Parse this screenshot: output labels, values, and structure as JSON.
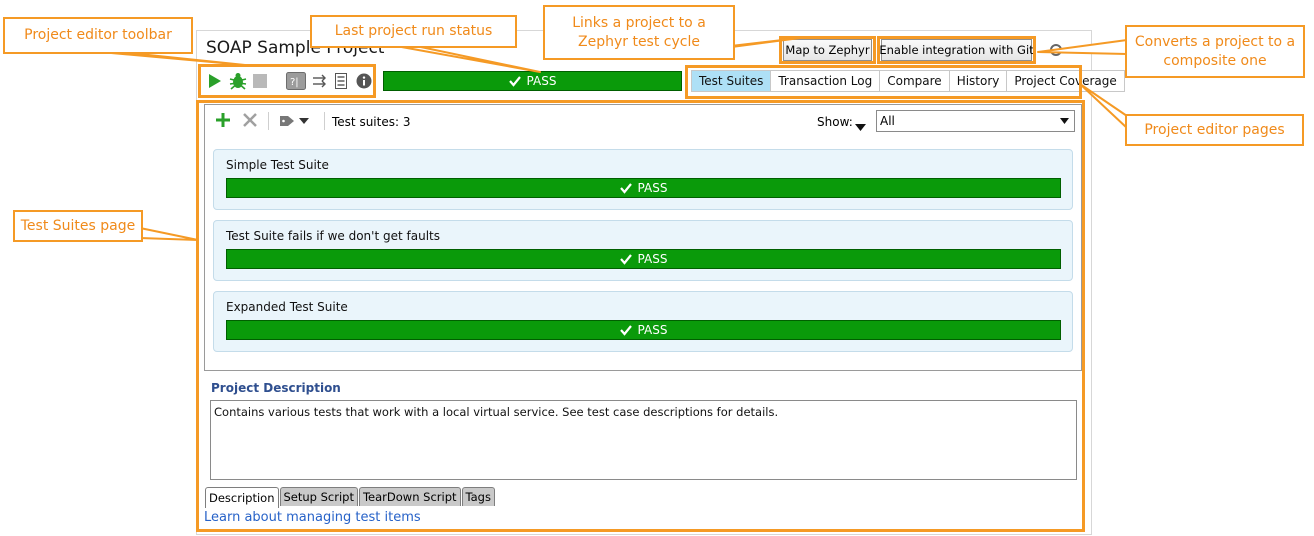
{
  "project": {
    "title": "SOAP Sample Project"
  },
  "toolbar": {
    "items": [
      "run-icon",
      "debug-icon",
      "stop-icon",
      "bracket-toggle-icon",
      "shuffle-icon",
      "list-icon",
      "info-icon"
    ]
  },
  "status": {
    "label": "PASS"
  },
  "page_tabs": [
    "Test Suites",
    "Transaction Log",
    "Compare",
    "History",
    "Project Coverage"
  ],
  "buttons": {
    "map_zephyr": "Map to Zephyr",
    "enable_git": "Enable integration with Git"
  },
  "suites": {
    "count_label": "Test suites: 3",
    "show_label": "Show:",
    "show_value": "All",
    "items": [
      {
        "name": "Simple Test Suite",
        "status": "PASS"
      },
      {
        "name": "Test Suite fails if we don't get faults",
        "status": "PASS"
      },
      {
        "name": "Expanded Test Suite",
        "status": "PASS"
      }
    ]
  },
  "description": {
    "title": "Project Description",
    "text": "Contains various tests that work with a local virtual service. See test case descriptions for details."
  },
  "bottom_tabs": [
    "Description",
    "Setup Script",
    "TearDown Script",
    "Tags"
  ],
  "learn_link": "Learn about managing test items",
  "callouts": {
    "toolbar": "Project editor toolbar",
    "last_run": "Last project run status",
    "zephyr": "Links a project to a Zephyr test cycle",
    "composite": "Converts a project to a composite one",
    "pages": "Project editor pages",
    "suites_page": "Test Suites page"
  },
  "colors": {
    "pass_green": "#0a9a0a",
    "accent_orange": "#f59a25",
    "active_tab": "#aee0f6",
    "link_blue": "#2762c8"
  }
}
